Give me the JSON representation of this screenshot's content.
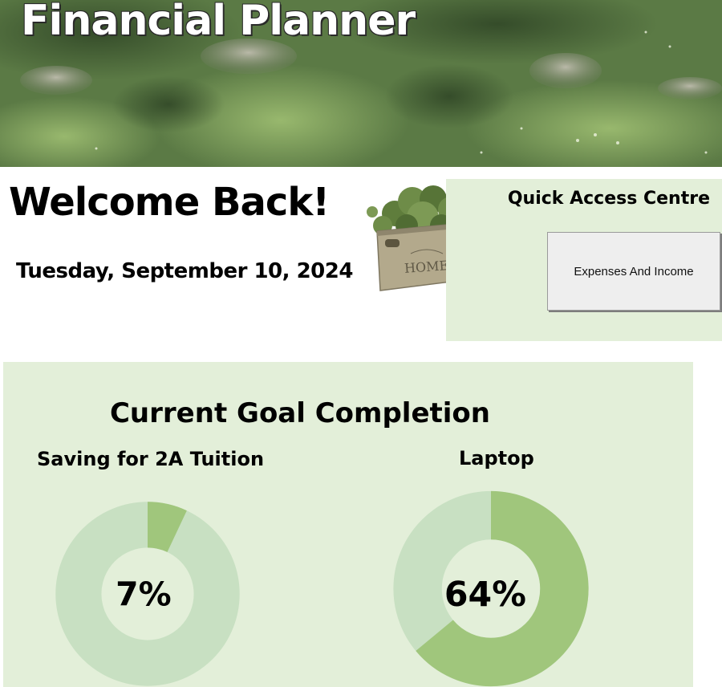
{
  "header": {
    "title": "Financial Planner"
  },
  "welcome": {
    "heading": "Welcome Back!",
    "date": "Tuesday, September 10, 2024"
  },
  "quick_access": {
    "title": "Quick Access Centre",
    "button_label": "Expenses And Income"
  },
  "goals": {
    "title": "Current Goal Completion",
    "items": [
      {
        "name": "Saving for 2A Tuition",
        "percent_label": "7%",
        "progress": 0.07
      },
      {
        "name": "Laptop",
        "percent_label": "64%",
        "progress": 0.64
      }
    ]
  },
  "colors": {
    "panel_bg": "#e3efd9",
    "donut_filled": "#a0c67c",
    "donut_remaining": "#c8e0c2",
    "button_bg": "#eeeeee"
  },
  "icons": {
    "plant_image": "potted-plant-crate-image",
    "banner_image": "forest-garden-image"
  }
}
